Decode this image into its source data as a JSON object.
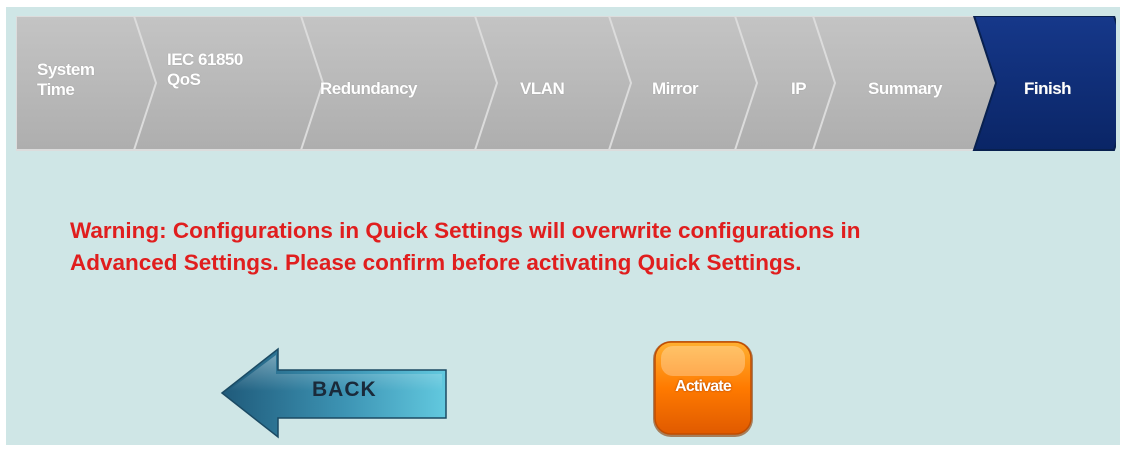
{
  "wizard": {
    "steps": [
      {
        "label": "System\nTime",
        "state": "inactive"
      },
      {
        "label": "IEC 61850\nQoS",
        "state": "inactive"
      },
      {
        "label": "Redundancy",
        "state": "inactive"
      },
      {
        "label": "VLAN",
        "state": "inactive"
      },
      {
        "label": "Mirror",
        "state": "inactive"
      },
      {
        "label": "IP",
        "state": "inactive"
      },
      {
        "label": "Summary",
        "state": "inactive"
      },
      {
        "label": "Finish",
        "state": "active"
      }
    ],
    "active_color": "#0d2c75",
    "inactive_color": "#b5b5b5"
  },
  "warning": {
    "text": "Warning: Configurations in Quick Settings will overwrite configurations in\nAdvanced Settings. Please confirm before activating Quick Settings.",
    "color": "#e01e1e"
  },
  "buttons": {
    "back_label": "BACK",
    "back_icon": "left-arrow-icon",
    "activate_label": "Activate"
  }
}
